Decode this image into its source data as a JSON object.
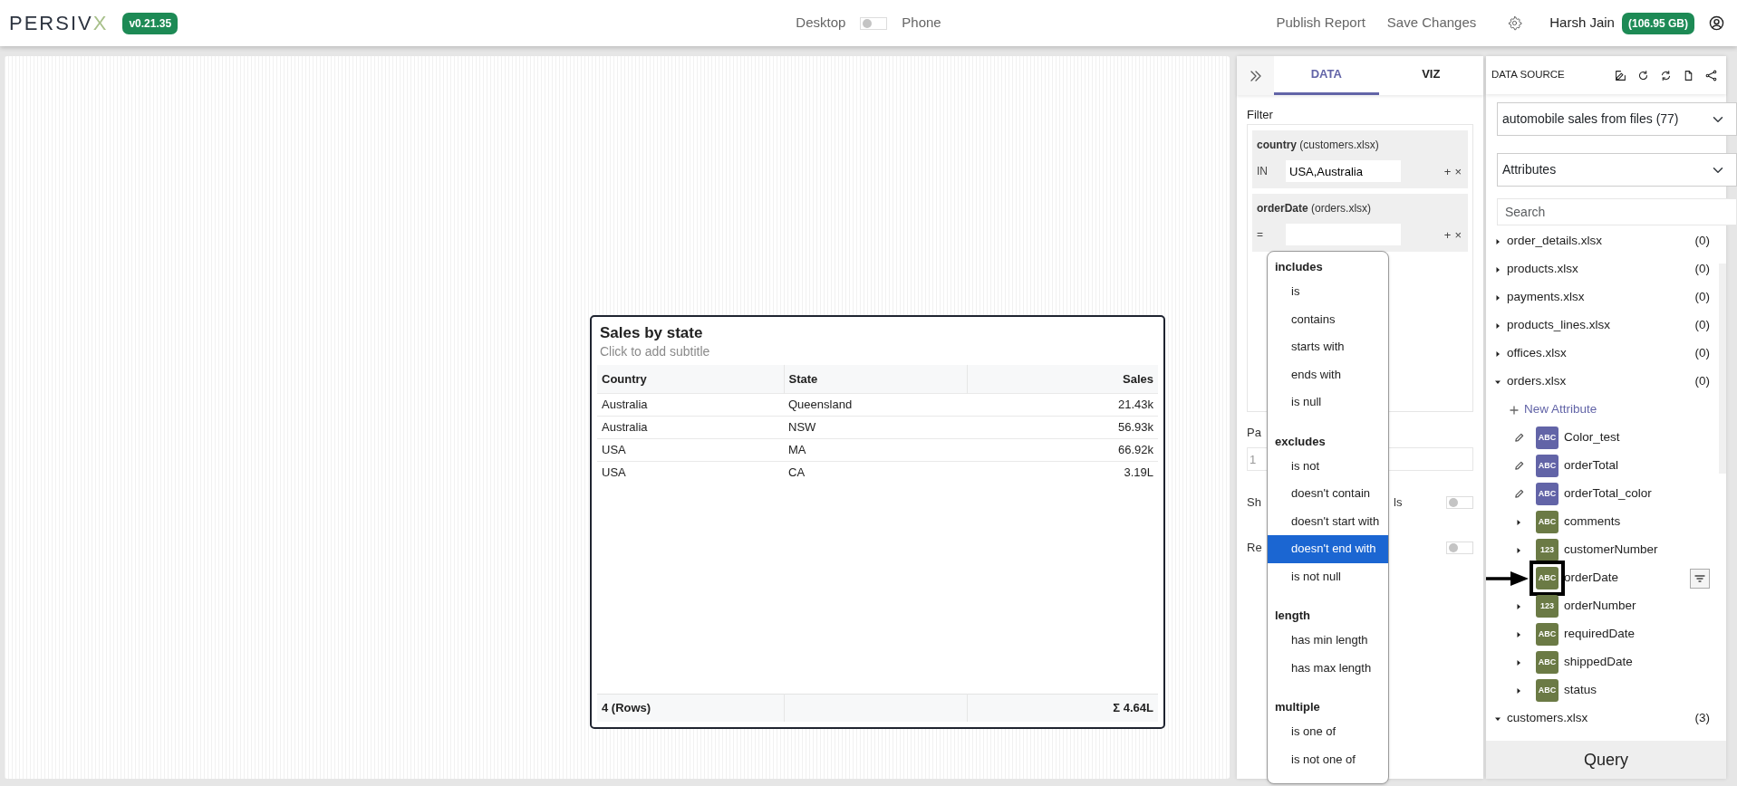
{
  "header": {
    "logo": {
      "text": "PERSIV",
      "accent": "X"
    },
    "version": "v0.21.35",
    "view_toggle": {
      "left": "Desktop",
      "right": "Phone",
      "on": false
    },
    "actions": [
      "Publish Report",
      "Save Changes"
    ],
    "user": "Harsh Jain",
    "storage": "(106.95 GB)"
  },
  "canvas": {
    "widget": {
      "title": "Sales by state",
      "subtitle": "Click to add subtitle",
      "columns": [
        "Country",
        "State",
        "Sales"
      ],
      "rows": [
        [
          "Australia",
          "Queensland",
          "21.43k"
        ],
        [
          "Australia",
          "NSW",
          "56.93k"
        ],
        [
          "USA",
          "MA",
          "66.92k"
        ],
        [
          "USA",
          "CA",
          "3.19L"
        ]
      ],
      "footer": {
        "rows_count": "4 (Rows)",
        "total": "Σ 4.64L"
      }
    }
  },
  "query_panel": {
    "tabs": [
      {
        "label": "DATA",
        "selected": true
      },
      {
        "label": "VIZ",
        "selected": false
      }
    ],
    "filter_label": "Filter",
    "filters": [
      {
        "field": "country",
        "source": "(customers.xlsx)",
        "operator": "IN",
        "value": "USA,Australia",
        "buttons": [
          "+",
          "×"
        ]
      },
      {
        "field": "orderDate",
        "source": "(orders.xlsx)",
        "operator": "=",
        "buttons": [
          "+",
          "×"
        ]
      }
    ],
    "settings": [
      {
        "kind": "input",
        "label": "Pa",
        "value": "1"
      },
      {
        "kind": "toggle",
        "label": "Sh",
        "label_end": "ls",
        "on": false
      },
      {
        "kind": "toggle",
        "label": "Re",
        "on": false
      }
    ],
    "operator_menu": {
      "groups": [
        {
          "label": "includes",
          "options": [
            {
              "label": "is",
              "selected": false
            },
            {
              "label": "contains",
              "selected": false
            },
            {
              "label": "starts with",
              "selected": false
            },
            {
              "label": "ends with",
              "selected": false
            },
            {
              "label": "is null",
              "selected": false
            }
          ]
        },
        {
          "label": "excludes",
          "options": [
            {
              "label": "is not",
              "selected": false
            },
            {
              "label": "doesn't contain",
              "selected": false
            },
            {
              "label": "doesn't start with",
              "selected": false
            },
            {
              "label": "doesn't end with",
              "selected": true
            },
            {
              "label": "is not null",
              "selected": false
            }
          ]
        },
        {
          "label": "length",
          "options": [
            {
              "label": "has min length",
              "selected": false
            },
            {
              "label": "has max length",
              "selected": false
            }
          ]
        },
        {
          "label": "multiple",
          "options": [
            {
              "label": "is one of",
              "selected": false
            },
            {
              "label": "is not one of",
              "selected": false
            }
          ]
        }
      ]
    }
  },
  "data_source": {
    "title": "DATA SOURCE",
    "source": "automobile sales from files (77)",
    "view": "Attributes",
    "search_placeholder": "Search",
    "files": [
      {
        "name": "order_details.xlsx",
        "count": "(0)",
        "expanded": false
      },
      {
        "name": "products.xlsx",
        "count": "(0)",
        "expanded": false
      },
      {
        "name": "payments.xlsx",
        "count": "(0)",
        "expanded": false
      },
      {
        "name": "products_lines.xlsx",
        "count": "(0)",
        "expanded": false
      },
      {
        "name": "offices.xlsx",
        "count": "(0)",
        "expanded": false
      },
      {
        "name": "orders.xlsx",
        "count": "(0)",
        "expanded": true,
        "new_attribute": "New Attribute",
        "attributes": [
          {
            "kind": "calculated",
            "type": "ABC",
            "name": "Color_test",
            "filtered": false,
            "highlighted": false
          },
          {
            "kind": "calculated",
            "type": "ABC",
            "name": "orderTotal",
            "filtered": false,
            "highlighted": false
          },
          {
            "kind": "calculated",
            "type": "ABC",
            "name": "orderTotal_color",
            "filtered": false,
            "highlighted": false
          },
          {
            "kind": "field",
            "type": "ABC",
            "name": "comments",
            "expanded": false,
            "filtered": false,
            "highlighted": false
          },
          {
            "kind": "field",
            "type": "123",
            "name": "customerNumber",
            "expanded": false,
            "filtered": false,
            "highlighted": false
          },
          {
            "kind": "field",
            "type": "ABC",
            "name": "orderDate",
            "filtered": true,
            "highlighted": true
          },
          {
            "kind": "field",
            "type": "123",
            "name": "orderNumber",
            "expanded": false,
            "filtered": false,
            "highlighted": false
          },
          {
            "kind": "field",
            "type": "ABC",
            "name": "requiredDate",
            "expanded": false,
            "filtered": false,
            "highlighted": false
          },
          {
            "kind": "field",
            "type": "ABC",
            "name": "shippedDate",
            "expanded": false,
            "filtered": false,
            "highlighted": false
          },
          {
            "kind": "field",
            "type": "ABC",
            "name": "status",
            "expanded": false,
            "filtered": false,
            "highlighted": false
          }
        ]
      },
      {
        "name": "customers.xlsx",
        "count": "(3)",
        "expanded": true
      }
    ],
    "query_button": "Query"
  }
}
